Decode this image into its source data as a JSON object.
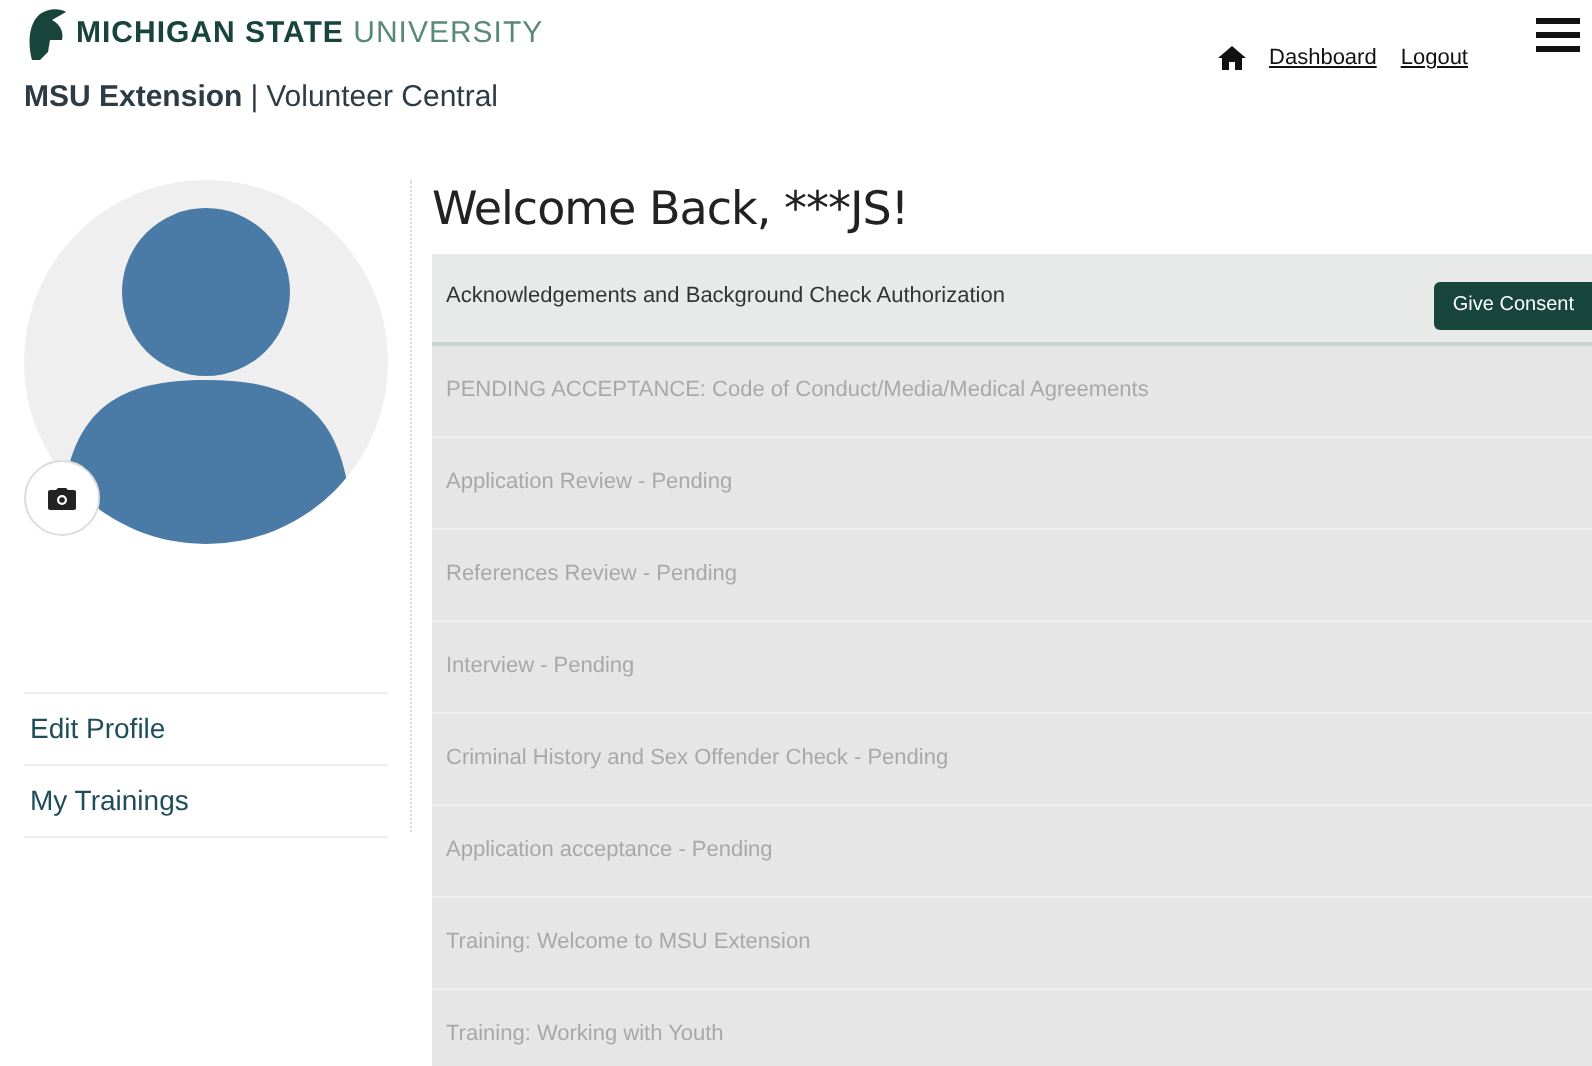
{
  "header": {
    "logo_bold": "MICHIGAN STATE",
    "logo_light": "UNIVERSITY",
    "site_bold": "MSU Extension",
    "site_sep": "|",
    "site_rest": "Volunteer Central",
    "links": [
      "Dashboard",
      "Logout"
    ]
  },
  "sidebar": {
    "items": [
      "Edit Profile",
      "My Trainings"
    ]
  },
  "main": {
    "title": "Welcome Back, ***JS!",
    "steps": [
      {
        "label": "Acknowledgements and Background Check Authorization",
        "disabled": false,
        "button": "Give Consent"
      },
      {
        "label": "PENDING ACCEPTANCE: Code of Conduct/Media/Medical Agreements",
        "disabled": true
      },
      {
        "label": "Application Review - Pending",
        "disabled": true
      },
      {
        "label": "References Review - Pending",
        "disabled": true
      },
      {
        "label": "Interview - Pending",
        "disabled": true
      },
      {
        "label": "Criminal History and Sex Offender Check - Pending",
        "disabled": true
      },
      {
        "label": "Application acceptance - Pending",
        "disabled": true
      },
      {
        "label": "Training: Welcome to MSU Extension",
        "disabled": true
      },
      {
        "label": "Training: Working with Youth",
        "disabled": true
      }
    ]
  }
}
